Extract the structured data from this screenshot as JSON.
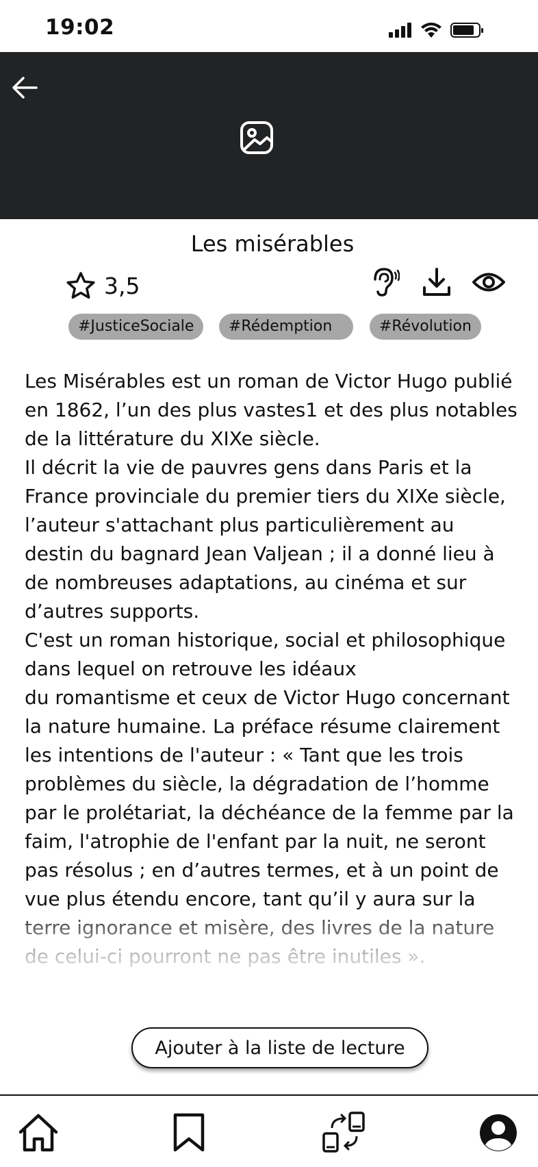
{
  "status_bar": {
    "time": "19:02"
  },
  "book": {
    "title": "Les misérables",
    "rating": "3,5",
    "tags": [
      "#JusticeSociale",
      "#Rédemption",
      "#Révolution"
    ],
    "description": [
      "Les Misérables est un roman de Victor Hugo publié en 1862, l’un des plus vastes1 et des plus notables de la littérature du XIXe siècle.",
      "Il décrit la vie de pauvres gens dans Paris et la France provinciale du premier tiers du XIXe siècle, l’auteur s'attachant plus particulièrement au destin du bagnard Jean Valjean ; il a donné lieu à de nombreuses adaptations, au cinéma et sur d’autres supports.",
      "C'est un roman historique, social et philosophique dans lequel on retrouve les idéaux",
      "du romantisme et ceux de Victor Hugo concernant la nature humaine. La préface résume clairement les intentions de l'auteur : « Tant que les trois problèmes du siècle, la dégradation de l’homme par le prolétariat, la déchéance de la femme par la faim, l'atrophie de l'enfant par la nuit, ne seront pas résolus ; en d’autres termes, et à un point de vue plus étendu encore, tant qu’il y aura sur la terre ignorance et misère, des livres de la nature de celui-ci pourront ne pas être inutiles »."
    ]
  },
  "actions": {
    "add_to_list_label": "Ajouter à la liste de lecture"
  },
  "icons": {
    "back": "arrow-left-icon",
    "cover": "image-placeholder-icon",
    "rating": "star-icon",
    "listen": "ear-icon",
    "download": "download-icon",
    "view": "eye-icon",
    "nav": [
      "home-icon",
      "bookmark-icon",
      "exchange-icon",
      "profile-icon"
    ]
  },
  "colors": {
    "cover_bg": "#222325",
    "tag_bg": "#a7a7a7",
    "text": "#111111"
  }
}
